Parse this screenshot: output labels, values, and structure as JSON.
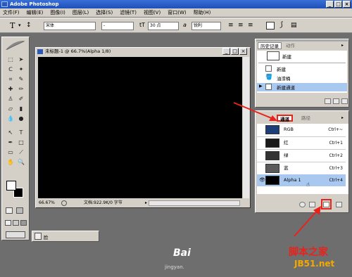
{
  "window": {
    "title": "Adobe Photoshop"
  },
  "menu": [
    "文件(F)",
    "编辑(E)",
    "图像(I)",
    "图层(L)",
    "选择(S)",
    "滤镜(T)",
    "视图(V)",
    "窗口(W)",
    "帮助(H)"
  ],
  "options": {
    "tool_glyph": "T",
    "font_family": "宋体",
    "font_style": "-",
    "font_size": "30 点",
    "antialias_label": "a",
    "antialias": "锐利"
  },
  "document": {
    "title": "未标题-1 @ 66.7%(Alpha 1/8)",
    "zoom": "66.67%",
    "info": "文档:922.9K/0 字节"
  },
  "history": {
    "tabs": [
      "历史记录",
      "动作"
    ],
    "snapshot_label": "新建",
    "items": [
      "新建",
      "油漆桶",
      "新建通道"
    ]
  },
  "channels": {
    "tabs": [
      "通道",
      "路径"
    ],
    "items": [
      {
        "name": "RGB",
        "shortcut": "Ctrl+~",
        "color": "#1c3f7a"
      },
      {
        "name": "红",
        "shortcut": "Ctrl+1",
        "color": "#1a1a1a"
      },
      {
        "name": "绿",
        "shortcut": "Ctrl+2",
        "color": "#333333"
      },
      {
        "name": "蓝",
        "shortcut": "Ctrl+3",
        "color": "#5a5a5a"
      },
      {
        "name": "Alpha 1",
        "shortcut": "Ctrl+4",
        "color": "#000000"
      }
    ]
  },
  "colors": {
    "highlight": "#a8c8f0",
    "annotation": "#e8231c",
    "titlebar": "#2a5bc8"
  },
  "watermark": {
    "site": "脚本之家",
    "domain": "JB51.net",
    "small": "jingyan.",
    "logo": "Bai"
  },
  "bottom_tab": "脸"
}
